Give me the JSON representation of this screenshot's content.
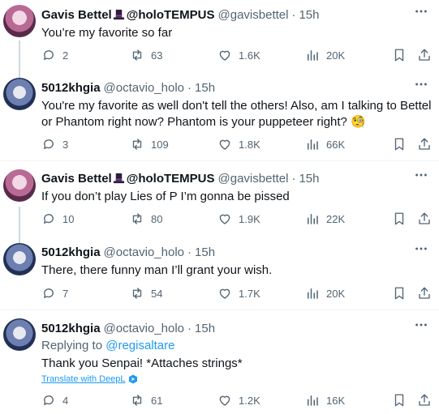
{
  "tweets": [
    {
      "name": "Gavis Bettel",
      "name_suffix": "@holoTEMPUS",
      "handle": "@gavisbettel",
      "time": "15h",
      "text": "You’re my favorite so far",
      "replies": "2",
      "retweets": "63",
      "likes": "1.6K",
      "views": "20K"
    },
    {
      "name": "5012khgia",
      "handle": "@octavio_holo",
      "time": "15h",
      "text": "You're my favorite as well don't tell the others! Also, am I talking to Bettel or Phantom right now? Phantom is your puppeteer right? 🧐",
      "replies": "3",
      "retweets": "109",
      "likes": "1.8K",
      "views": "66K"
    },
    {
      "name": "Gavis Bettel",
      "name_suffix": "@holoTEMPUS",
      "handle": "@gavisbettel",
      "time": "15h",
      "text": "If you don’t play Lies of P I’m gonna be pissed",
      "replies": "10",
      "retweets": "80",
      "likes": "1.9K",
      "views": "22K"
    },
    {
      "name": "5012khgia",
      "handle": "@octavio_holo",
      "time": "15h",
      "text": "There, there funny man I’ll grant your wish.",
      "replies": "7",
      "retweets": "54",
      "likes": "1.7K",
      "views": "20K"
    },
    {
      "name": "5012khgia",
      "handle": "@octavio_holo",
      "time": "15h",
      "reply_prefix": "Replying to",
      "reply_target": "@regisaltare",
      "text": "Thank you Senpai! *Attaches strings*",
      "translate": "Translate with DeepL",
      "replies": "4",
      "retweets": "61",
      "likes": "1.2K",
      "views": "16K"
    }
  ],
  "separator": "·",
  "icons": {
    "reply": "reply-icon",
    "retweet": "retweet-icon",
    "like": "heart-icon",
    "views": "views-icon",
    "bookmark": "bookmark-icon",
    "share": "share-icon",
    "more": "more-icon",
    "hat": "top-hat-emoji"
  },
  "colors": {
    "text": "#0f1419",
    "secondary": "#536471",
    "link": "#1d9bf0",
    "thread_line": "#cfd9de",
    "divider": "#eff3f4"
  }
}
